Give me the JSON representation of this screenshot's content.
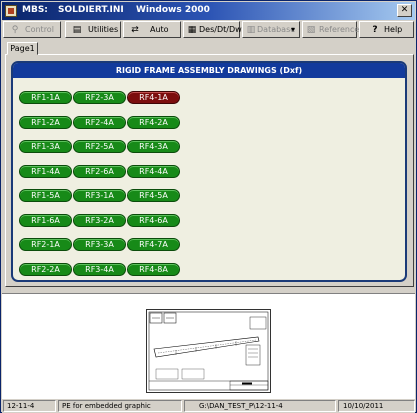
{
  "window": {
    "app": "MBS:",
    "file": "SOLDIERT.INI",
    "os": "Windows 2000",
    "close_label": "✕"
  },
  "toolbar": [
    {
      "label": "Control",
      "icon": "control-icon",
      "glyph": "⚲",
      "enabled": false
    },
    {
      "label": "Utilities",
      "icon": "utilities-icon",
      "glyph": "▤",
      "enabled": true
    },
    {
      "label": "Auto",
      "icon": "auto-icon",
      "glyph": "⇄",
      "enabled": true
    },
    {
      "label": "Des/Dt/Dwg",
      "icon": "drawing-icon",
      "glyph": "▦",
      "enabled": true
    },
    {
      "label": "Database",
      "icon": "database-icon",
      "glyph": "▥",
      "enabled": false
    },
    {
      "label": "Reference",
      "icon": "reference-icon",
      "glyph": "▧",
      "enabled": false
    },
    {
      "label": "Help",
      "icon": "help-icon",
      "glyph": "?",
      "enabled": true
    }
  ],
  "tab": {
    "label": "Page1"
  },
  "panel": {
    "title": "RIGID FRAME ASSEMBLY DRAWINGS (Dxf)",
    "columns": [
      [
        "RF1-1A",
        "RF1-2A",
        "RF1-3A",
        "RF1-4A",
        "RF1-5A",
        "RF1-6A",
        "RF2-1A",
        "RF2-2A"
      ],
      [
        "RF2-3A",
        "RF2-4A",
        "RF2-5A",
        "RF2-6A",
        "RF3-1A",
        "RF3-2A",
        "RF3-3A",
        "RF3-4A"
      ],
      [
        "RF4-1A",
        "RF4-2A",
        "RF4-3A",
        "RF4-4A",
        "RF4-5A",
        "RF4-6A",
        "RF4-7A",
        "RF4-8A"
      ]
    ],
    "selected": "RF4-1A",
    "colors": {
      "button": "#178a18",
      "selected": "#7c0d0d",
      "header": "#123a9c",
      "panel_bg": "#efefe1"
    }
  },
  "status": {
    "left": "12-11-4",
    "message": "PE for embedded graphic",
    "path": "G:\\DAN_TEST_P\\12-11-4",
    "date": "10/10/2011"
  }
}
